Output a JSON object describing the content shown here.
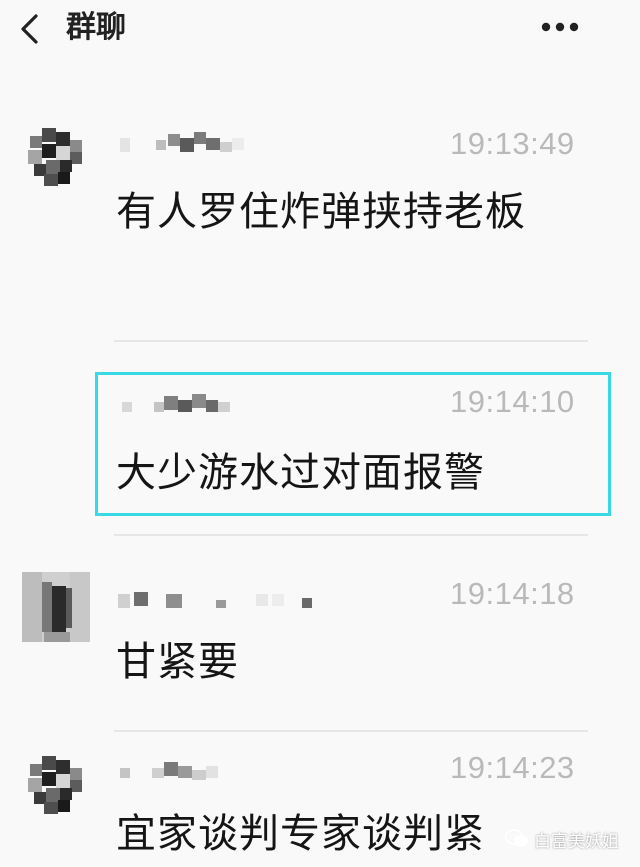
{
  "header": {
    "title": "群聊",
    "back_icon": "chevron-left-icon",
    "more_icon": "more-horizontal-icon"
  },
  "messages": [
    {
      "time": "19:13:49",
      "text": "有人罗住炸弹挟持老板"
    },
    {
      "time": "19:14:10",
      "text": "大少游水过对面报警"
    },
    {
      "time": "19:14:18",
      "text": "甘紧要"
    },
    {
      "time": "19:14:23",
      "text": "宜家谈判专家谈判紧"
    }
  ],
  "watermark": {
    "text": "白富美妖姐",
    "icon": "wechat-icon"
  },
  "colors": {
    "background": "#f9f9f9",
    "highlight_border": "#38d9e2",
    "timestamp": "#b9b9b9"
  }
}
